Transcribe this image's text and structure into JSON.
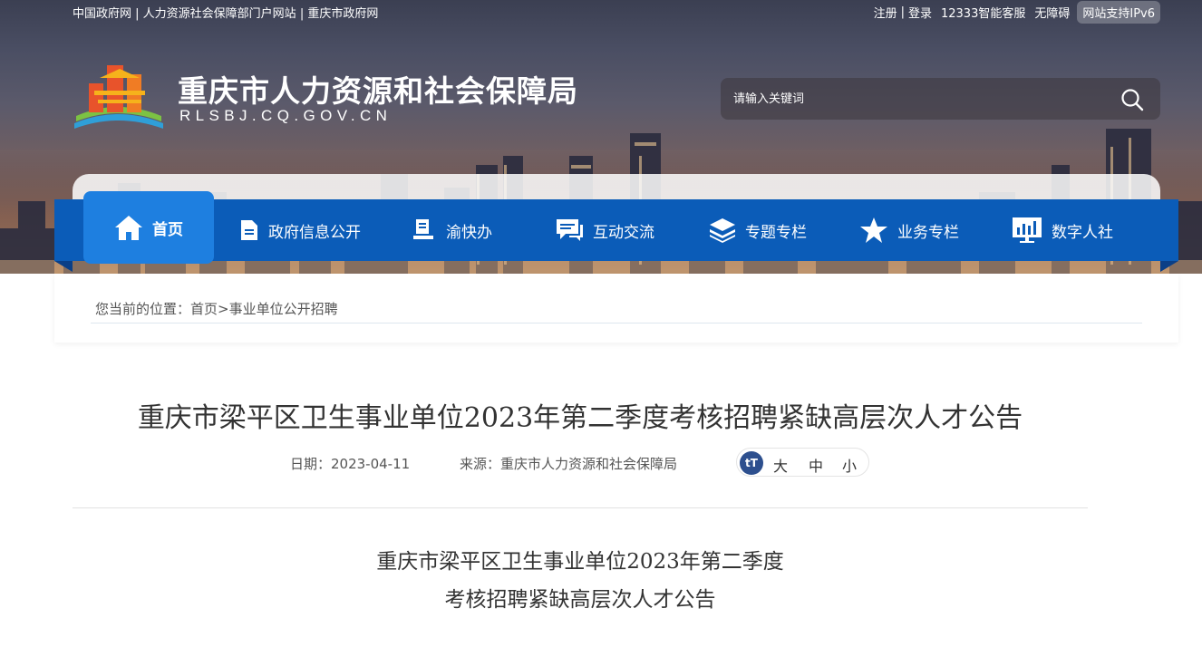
{
  "topbar": {
    "links": [
      "中国政府网",
      "人力资源社会保障部门户网站",
      "重庆市政府网"
    ],
    "register": "注册",
    "login": "登录",
    "hotline": "12333智能客服",
    "accessibility": "无障碍",
    "ipv6": "网站支持IPv6"
  },
  "header": {
    "title": "重庆市人力资源和社会保障局",
    "domain": "RLSBJ.CQ.GOV.CN",
    "search_placeholder": "请输入关键词"
  },
  "nav": {
    "items": [
      {
        "label": "首页",
        "icon": "home-icon"
      },
      {
        "label": "政府信息公开",
        "icon": "document-icon"
      },
      {
        "label": "渝快办",
        "icon": "desk-icon"
      },
      {
        "label": "互动交流",
        "icon": "chat-icon"
      },
      {
        "label": "专题专栏",
        "icon": "layers-icon"
      },
      {
        "label": "业务专栏",
        "icon": "star-icon"
      },
      {
        "label": "数字人社",
        "icon": "monitor-icon"
      }
    ]
  },
  "breadcrumb": {
    "prefix": "您当前的位置：",
    "home": "首页",
    "sep": ">",
    "current": "事业单位公开招聘"
  },
  "article": {
    "title": "重庆市梁平区卫生事业单位2023年第二季度考核招聘紧缺高层次人才公告",
    "date": "日期：2023-04-11",
    "source": "来源：重庆市人力资源和社会保障局",
    "fontsize": {
      "icon": "tT",
      "large": "大",
      "medium": "中",
      "small": "小"
    },
    "body_title_line1": "重庆市梁平区卫生事业单位2023年第二季度",
    "body_title_line2": "考核招聘紧缺高层次人才公告"
  },
  "colors": {
    "nav_bg": "#0b5cb8",
    "nav_active": "#1e7fe0",
    "fontsize_icon_bg": "#2d4f8e"
  }
}
